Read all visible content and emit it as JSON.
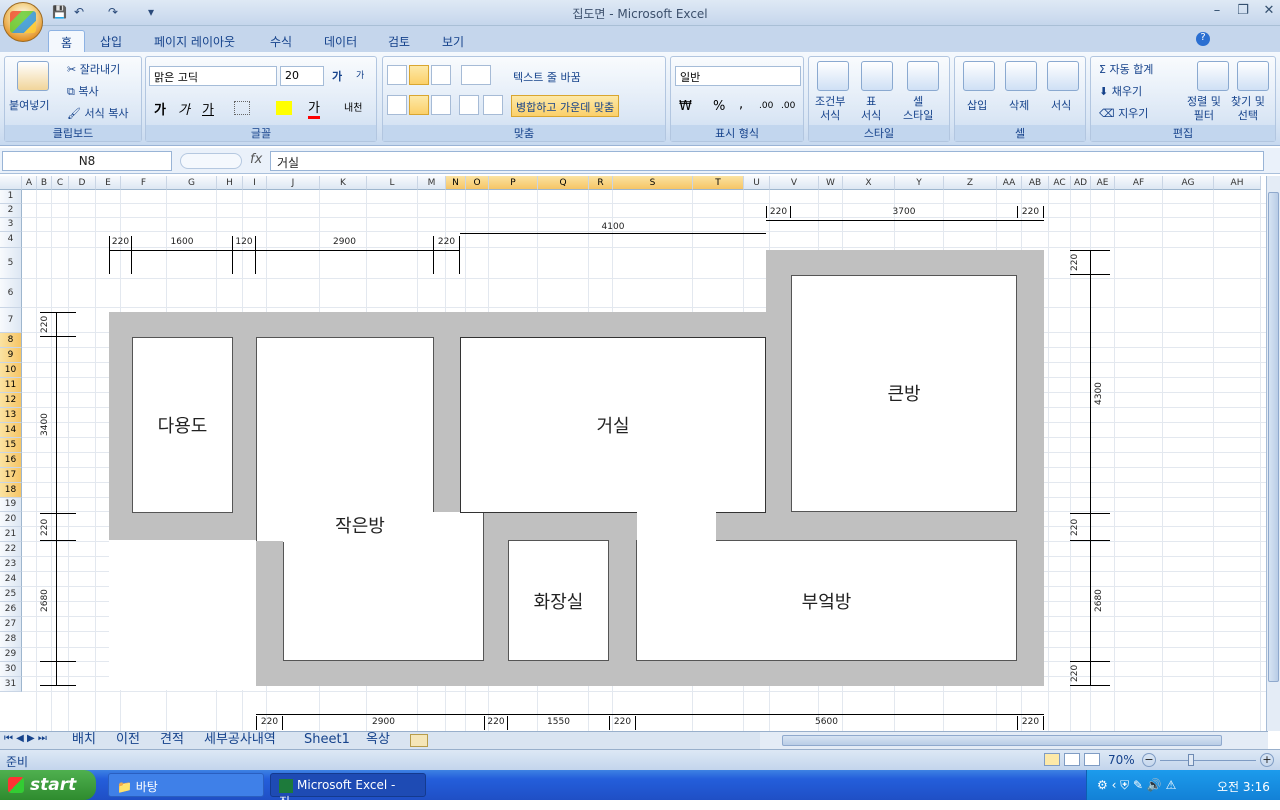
{
  "window": {
    "title": "집도면 - Microsoft Excel",
    "min": "–",
    "restore": "❐",
    "close": "✕"
  },
  "qat": {
    "save": "💾",
    "undo": "↶",
    "redo": "↷",
    "more": "▾"
  },
  "tabs": [
    "홈",
    "삽입",
    "페이지 레이아웃",
    "수식",
    "데이터",
    "검토",
    "보기"
  ],
  "ribbon": {
    "clipboard": {
      "label": "클립보드",
      "paste": "붙여넣기",
      "cut": "잘라내기",
      "copy": "복사",
      "format_painter": "서식 복사"
    },
    "font": {
      "label": "글꼴",
      "name": "맑은 고딕",
      "size": "20",
      "bold": "가",
      "italic": "가",
      "underline": "가",
      "grow": "가",
      "shrink": "가",
      "color_letter": "가",
      "phonetic": "내천"
    },
    "align": {
      "label": "맞춤",
      "wrap": "텍스트 줄 바꿈",
      "merge": "병합하고 가운데 맞춤"
    },
    "number": {
      "label": "표시 형식",
      "format": "일반",
      "currency": "₩",
      "percent": "%",
      "comma": ",",
      "inc_dec": ".00",
      "dec_dec": ".00"
    },
    "styles": {
      "label": "스타일",
      "conditional": "조건부\n서식",
      "table": "표\n서식",
      "cell": "셀\n스타일"
    },
    "cells": {
      "label": "셀",
      "insert": "삽입",
      "delete": "삭제",
      "format": "서식"
    },
    "editing": {
      "label": "편집",
      "autosum": "자동 합계",
      "fill": "채우기",
      "clear": "지우기",
      "sort": "정렬 및\n필터",
      "find": "찾기 및\n선택"
    }
  },
  "formula_bar": {
    "name_box": "N8",
    "fx": "fx",
    "value": "거실"
  },
  "columns": [
    "A",
    "B",
    "C",
    "D",
    "E",
    "F",
    "G",
    "H",
    "I",
    "J",
    "K",
    "L",
    "M",
    "N",
    "O",
    "P",
    "Q",
    "R",
    "S",
    "T",
    "U",
    "V",
    "W",
    "X",
    "Y",
    "Z",
    "AA",
    "AB",
    "AC",
    "AD",
    "AE",
    "AF",
    "AG",
    "AH"
  ],
  "selected_columns": [
    "N",
    "O",
    "P",
    "Q",
    "R",
    "S",
    "T"
  ],
  "rows": [
    "1",
    "2",
    "3",
    "4",
    "5",
    "6",
    "7",
    "8",
    "9",
    "10",
    "11",
    "12",
    "13",
    "14",
    "15",
    "16",
    "17",
    "18",
    "19",
    "20",
    "21",
    "22",
    "23",
    "24",
    "25",
    "26",
    "27",
    "28",
    "29",
    "30",
    "31"
  ],
  "selected_rows": [
    "8",
    "9",
    "10",
    "11",
    "12",
    "13",
    "14",
    "15",
    "16",
    "17",
    "18"
  ],
  "rooms": {
    "utility": "다용도",
    "small_room": "작은방",
    "living": "거실",
    "master": "큰방",
    "bathroom": "화장실",
    "kitchen": "부엌방"
  },
  "dims": {
    "top_right": [
      "220",
      "3700",
      "220"
    ],
    "top_mid": "4100",
    "top_left": [
      "220",
      "1600",
      "120",
      "2900",
      "220"
    ],
    "left": [
      "220",
      "3400",
      "220",
      "2680"
    ],
    "right": [
      "220",
      "4300",
      "220",
      "2680",
      "220"
    ],
    "bottom": [
      "220",
      "2900",
      "220",
      "1550",
      "220",
      "5600",
      "220"
    ]
  },
  "sheets": [
    "배치",
    "이전",
    "견적",
    "세부공사내역",
    "Sheet1",
    "옥상"
  ],
  "status": {
    "ready": "준비",
    "zoom": "70%"
  },
  "taskbar": {
    "start": "start",
    "folder": "바탕",
    "excel": "Microsoft Excel - 집...",
    "clock": "오전 3:16"
  }
}
